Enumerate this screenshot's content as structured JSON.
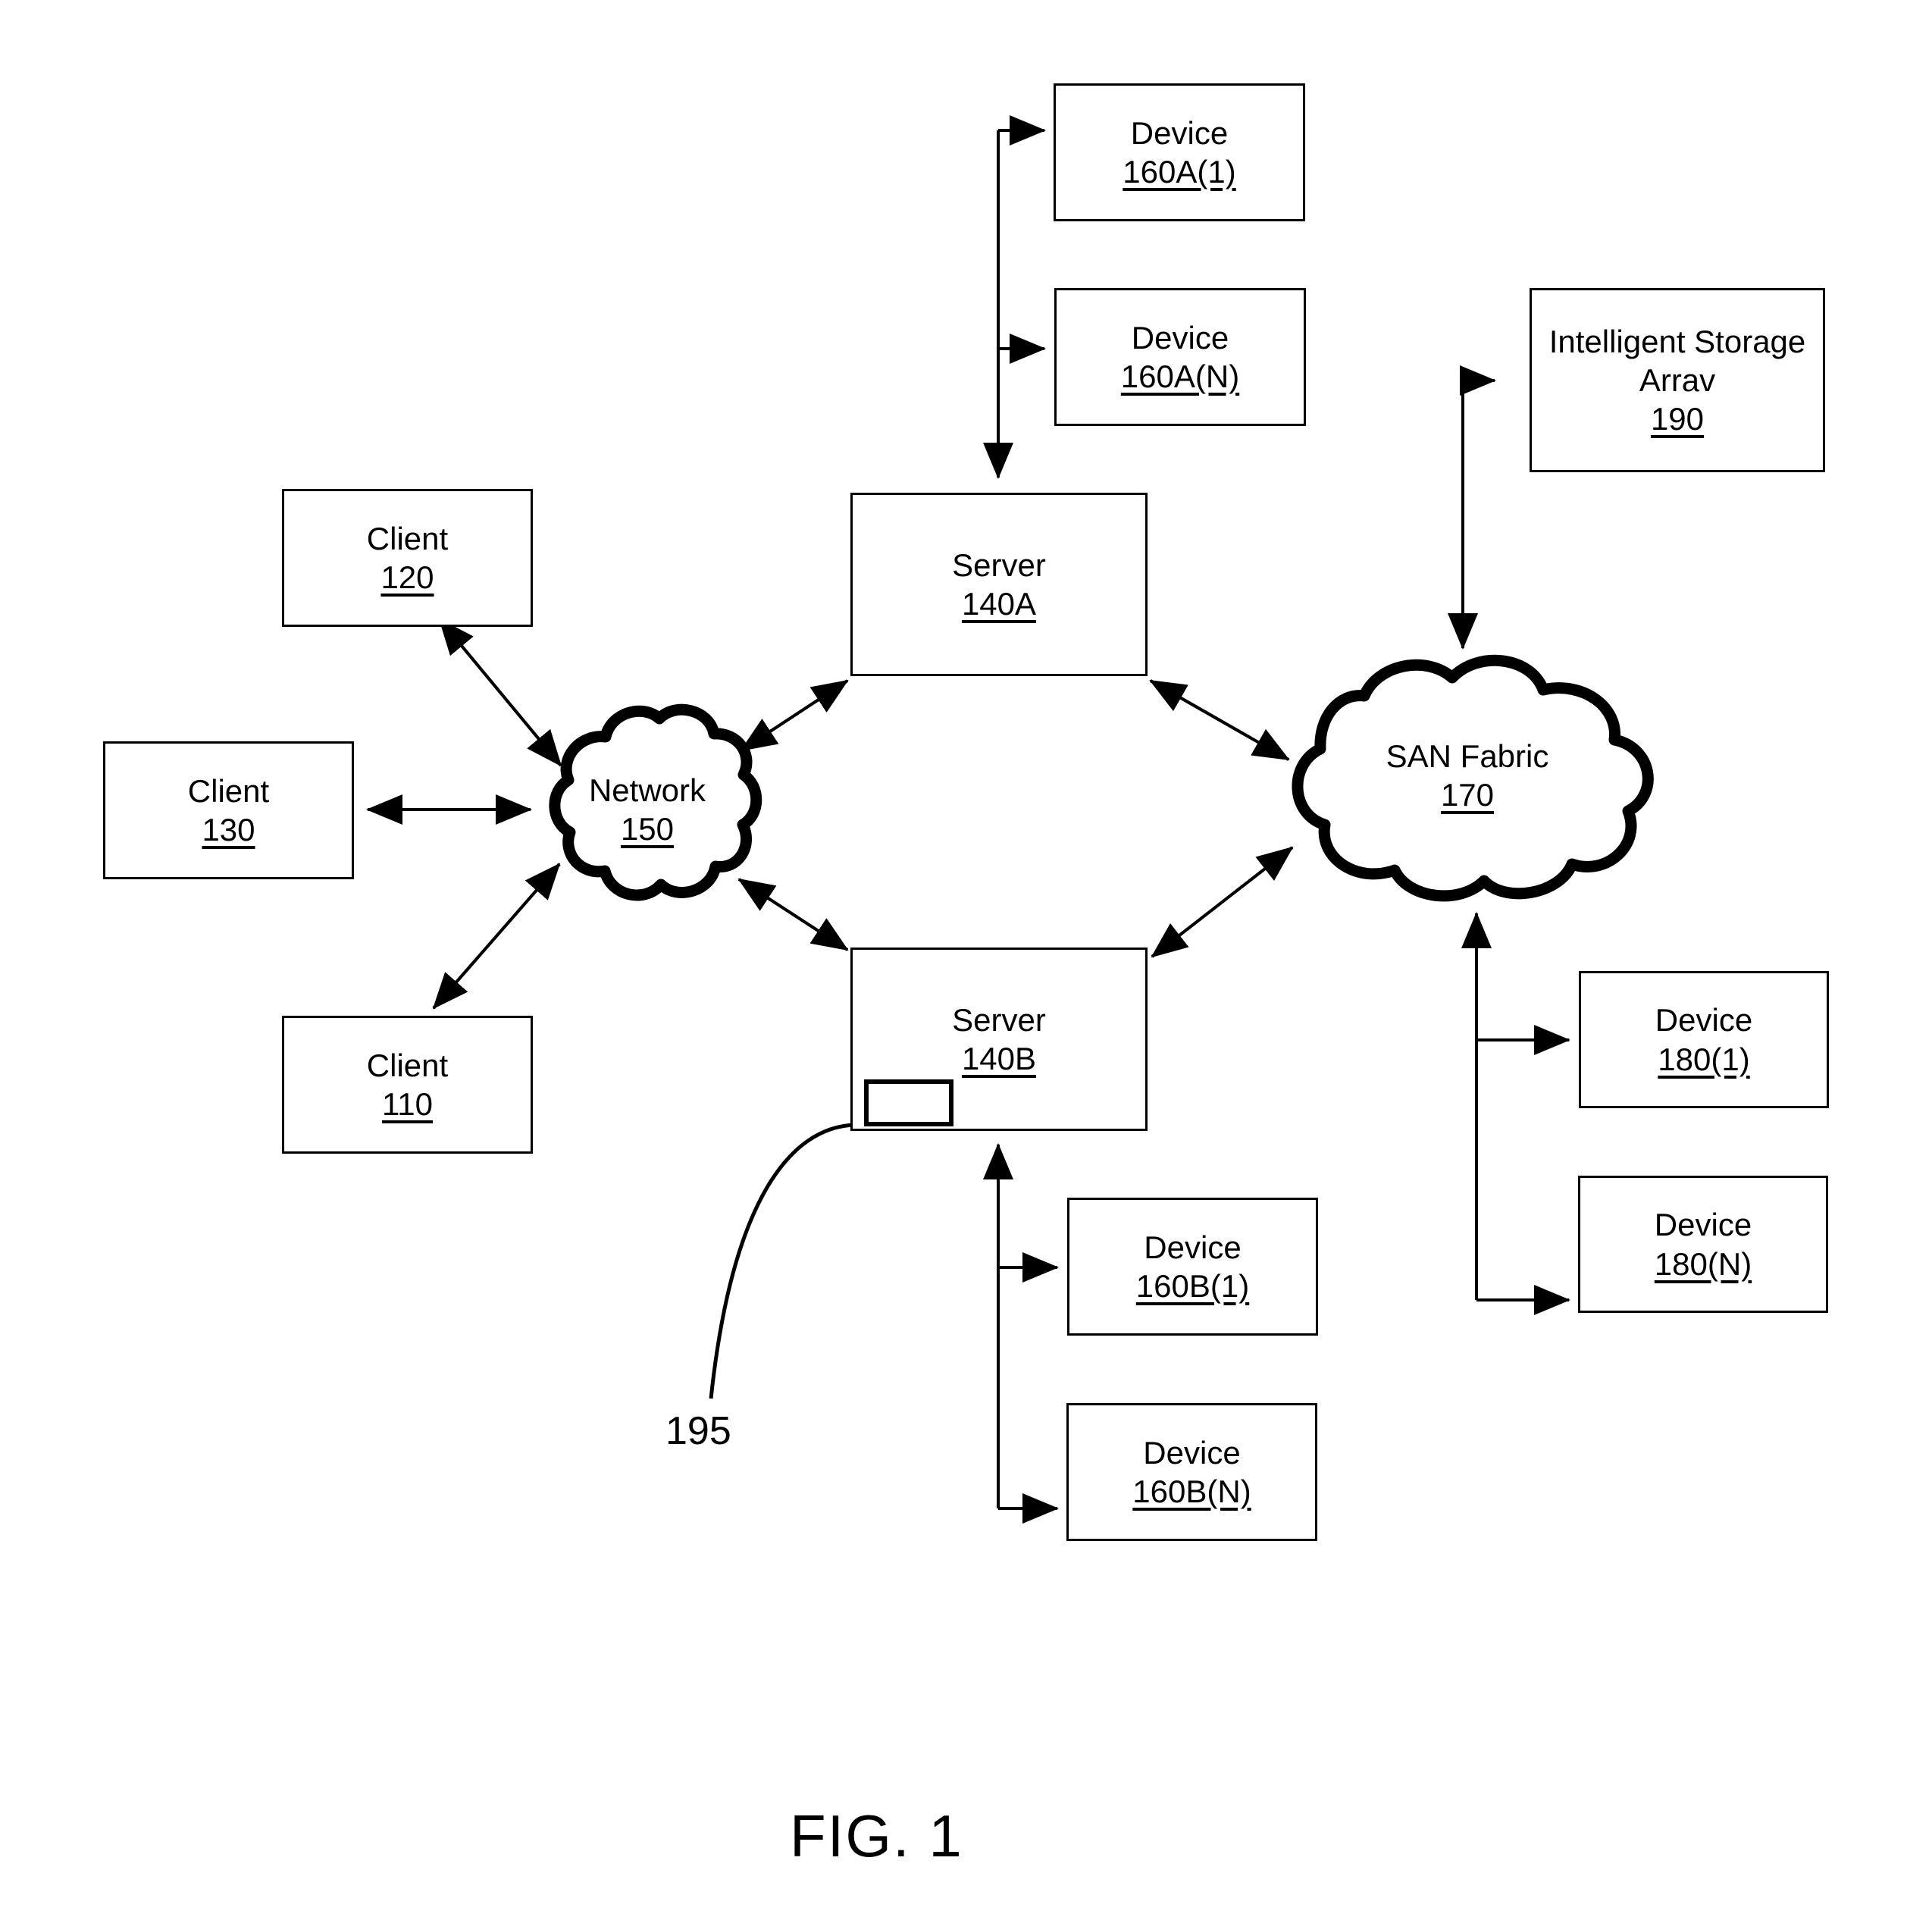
{
  "figure": {
    "caption": "FIG. 1",
    "leader_label": "195"
  },
  "nodes": {
    "device_160a_1": {
      "label": "Device",
      "ref": "160A(1)"
    },
    "device_160a_n": {
      "label": "Device",
      "ref": "160A(N)"
    },
    "intelligent_storage_array": {
      "label": "Intelligent Storage\nArrav",
      "ref": "190"
    },
    "client_120": {
      "label": "Client",
      "ref": "120"
    },
    "client_130": {
      "label": "Client",
      "ref": "130"
    },
    "client_110": {
      "label": "Client",
      "ref": "110"
    },
    "server_140a": {
      "label": "Server",
      "ref": "140A"
    },
    "server_140b": {
      "label": "Server",
      "ref": "140B"
    },
    "network": {
      "label": "Network",
      "ref": "150"
    },
    "san_fabric": {
      "label": "SAN Fabric",
      "ref": "170"
    },
    "device_160b_1": {
      "label": "Device",
      "ref": "160B(1)"
    },
    "device_160b_n": {
      "label": "Device",
      "ref": "160B(N)"
    },
    "device_180_1": {
      "label": "Device",
      "ref": "180(1)"
    },
    "device_180_n": {
      "label": "Device",
      "ref": "180(N)"
    }
  },
  "colors": {
    "stroke": "#000000",
    "background": "#ffffff"
  }
}
